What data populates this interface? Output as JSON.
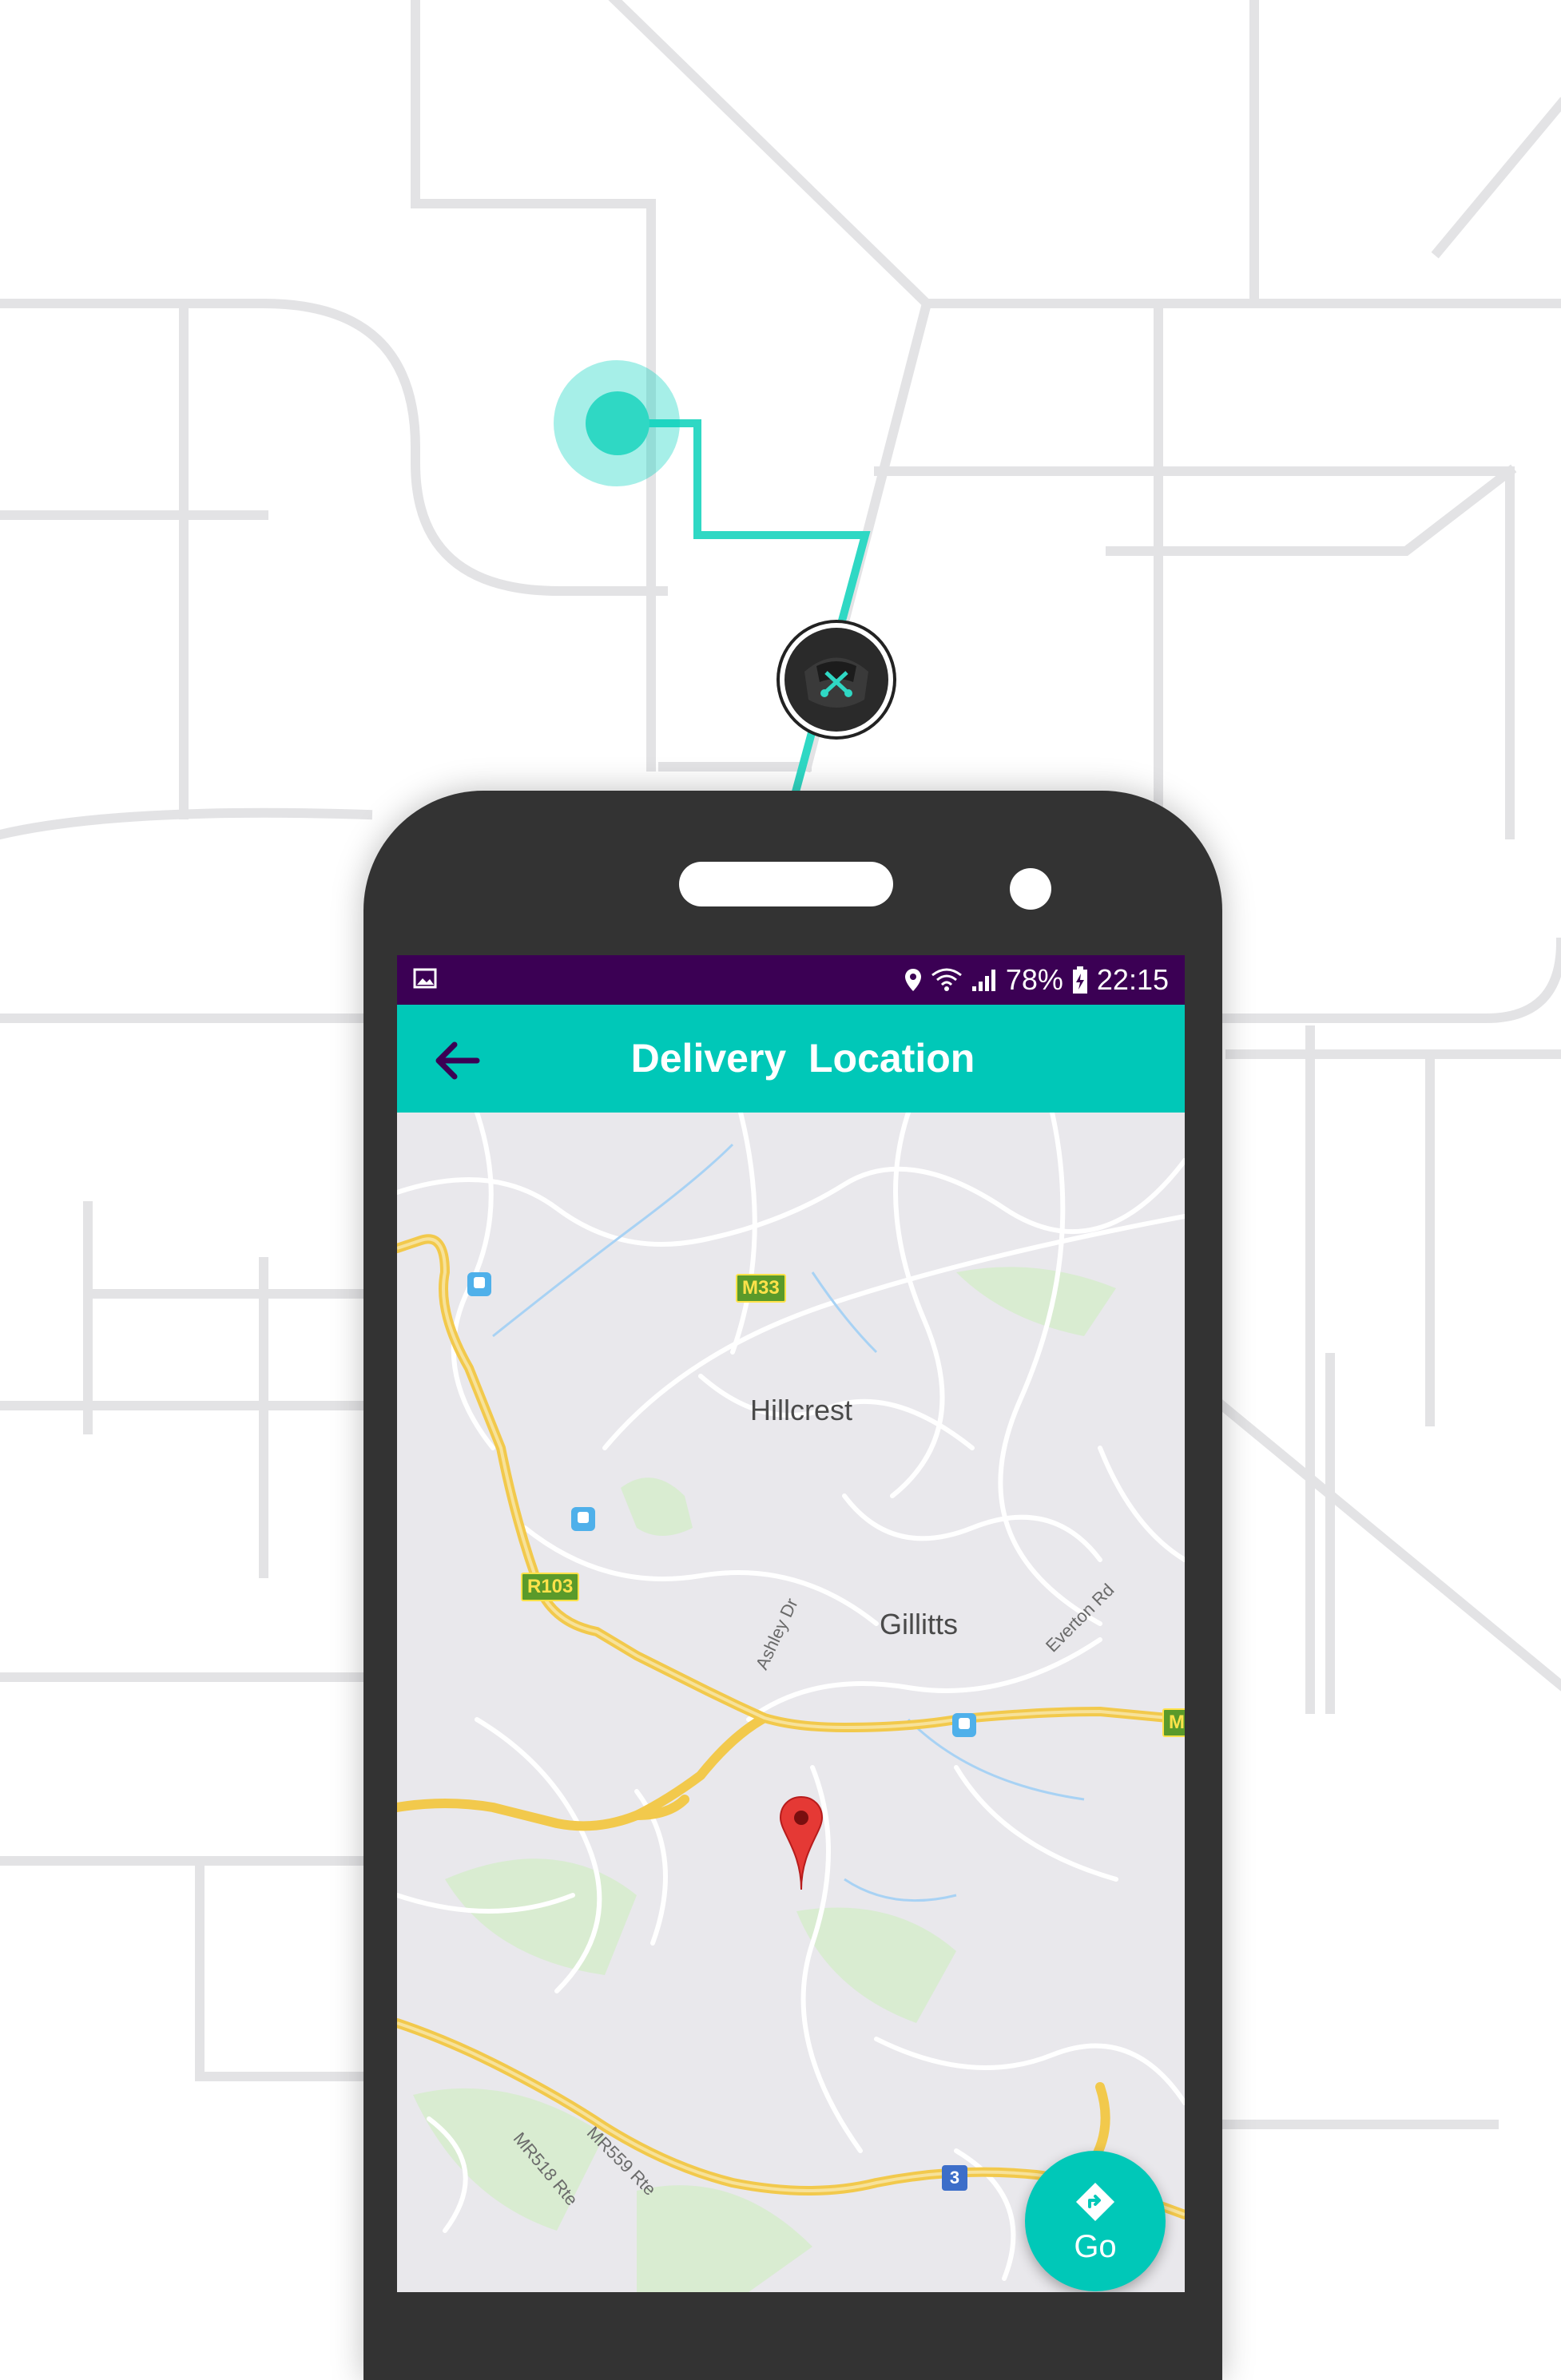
{
  "colors": {
    "accent": "#00c8b8",
    "status_bar": "#3b0054",
    "phone_body": "#333333",
    "route": "#2fd8c4",
    "background_lines": "#e3e3e5",
    "map_road_major": "#f7d36b",
    "map_road_minor": "#ffffff",
    "map_background": "#e9e8ec",
    "pin": "#e53935"
  },
  "background": {
    "route_start_icon": "location-pulse-icon",
    "driver_icon": "delivery-driver-icon"
  },
  "status_bar": {
    "left_icon": "image-notification-icon",
    "icons": [
      "location-icon",
      "wifi-icon",
      "signal-icon"
    ],
    "battery_percent": "78%",
    "battery_icon": "battery-charging-icon",
    "time": "22:15"
  },
  "app_bar": {
    "back_icon": "arrow-back-icon",
    "title": "Delivery  Location"
  },
  "map": {
    "places": [
      "Hillcrest",
      "Gillitts"
    ],
    "roads": [
      "Ashley Dr",
      "Everton Rd",
      "MR518 Rte",
      "MR559 Rte"
    ],
    "route_shields": [
      "M33",
      "R103",
      "M",
      "3"
    ],
    "marker_icon": "map-pin-icon",
    "transit_icon": "transit-station-icon"
  },
  "fab": {
    "icon": "directions-icon",
    "label": "Go"
  }
}
